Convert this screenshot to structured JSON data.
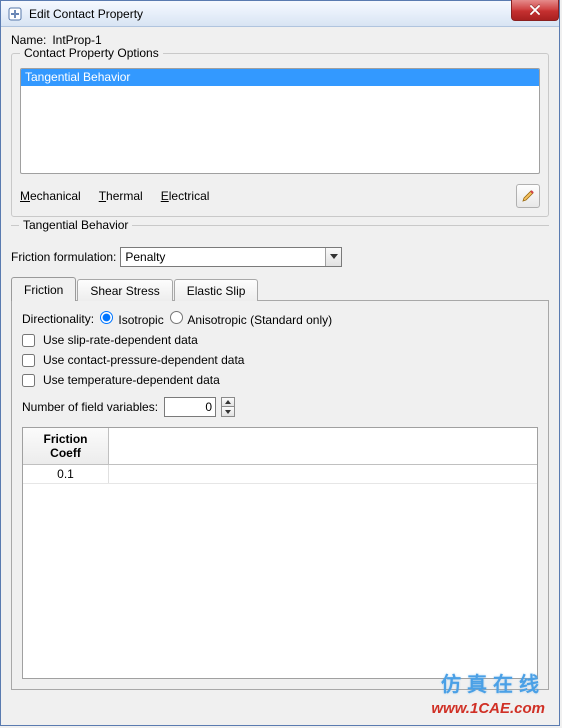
{
  "window": {
    "title": "Edit Contact Property"
  },
  "name": {
    "label": "Name:",
    "value": "IntProp-1"
  },
  "options_group": {
    "title": "Contact Property Options",
    "list": [
      "Tangential Behavior"
    ],
    "menus": {
      "mechanical": "Mechanical",
      "thermal": "Thermal",
      "electrical": "Electrical"
    }
  },
  "tangential": {
    "title": "Tangential Behavior",
    "friction_formulation": {
      "label": "Friction formulation:",
      "value": "Penalty"
    },
    "tabs": {
      "friction": "Friction",
      "shear": "Shear Stress",
      "elastic": "Elastic Slip"
    },
    "directionality": {
      "label": "Directionality:",
      "iso": "Isotropic",
      "aniso": "Anisotropic (Standard only)",
      "selected": "iso"
    },
    "checks": {
      "slip": "Use slip-rate-dependent data",
      "pressure": "Use contact-pressure-dependent data",
      "temp": "Use temperature-dependent data"
    },
    "numvars": {
      "label": "Number of field variables:",
      "value": "0"
    },
    "grid": {
      "header": "Friction\nCoeff",
      "rows": [
        "0.1"
      ]
    }
  },
  "watermark": {
    "cn": "仿真在线",
    "url": "www.1CAE.com"
  }
}
